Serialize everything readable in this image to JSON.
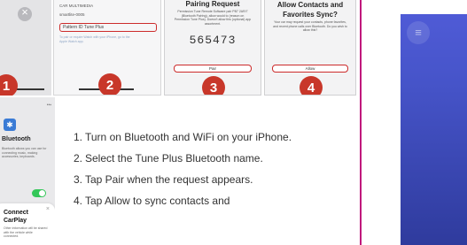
{
  "step_shots": [
    {
      "badge": "1"
    },
    {
      "badge": "2",
      "header": "CAR MULTIMEDIA",
      "device_id": "smartlite-0005",
      "device_name_value": "Pattern ID Tune Plus",
      "note": "To pair or require Watch with your iPhone, go to the Apple Watch app."
    },
    {
      "badge": "3",
      "title": "Pairing Request",
      "body": "Permission Tune Remote Software pair PB7 2AR/7 (Bluetooth Pairing), allow would to (reason on Permission Tune Plus). Doesn't allow this (optional) app assortment.",
      "code": "565473",
      "button": "Pair"
    },
    {
      "badge": "4",
      "title": "Allow Contacts and Favorites Sync?",
      "body": "Your car may request your contacts, phone favorites, and recent phone calls over Bluetooth. Do you wish to allow this?",
      "button": "Allow"
    }
  ],
  "phone_shot": {
    "signal": "••▪",
    "bluetooth_icon": "✱",
    "heading": "Bluetooth",
    "small_text": "Bluetooth allows you can use for connecting music, making accessories, keyboards.",
    "card": {
      "close": "×",
      "title_line1": "Connect",
      "title_line2": "CarPlay",
      "text": "Other information will be shared with the vehicle while connected."
    }
  },
  "instructions": [
    {
      "num": "1.",
      "text": "Turn on Bluetooth and WiFi on your iPhone."
    },
    {
      "num": "2.",
      "text": "Select the Tune Plus Bluetooth name."
    },
    {
      "num": "3.",
      "text": "Tap Pair when the request appears."
    },
    {
      "num": "4.",
      "text": "Tap Allow to sync contacts and"
    }
  ],
  "side_panel": {
    "icon_glyph": "≡"
  },
  "colors": {
    "step_badge": "#c8372a",
    "divider": "#c0187c",
    "panel": "#4654c9",
    "toggle_on": "#34c759"
  }
}
